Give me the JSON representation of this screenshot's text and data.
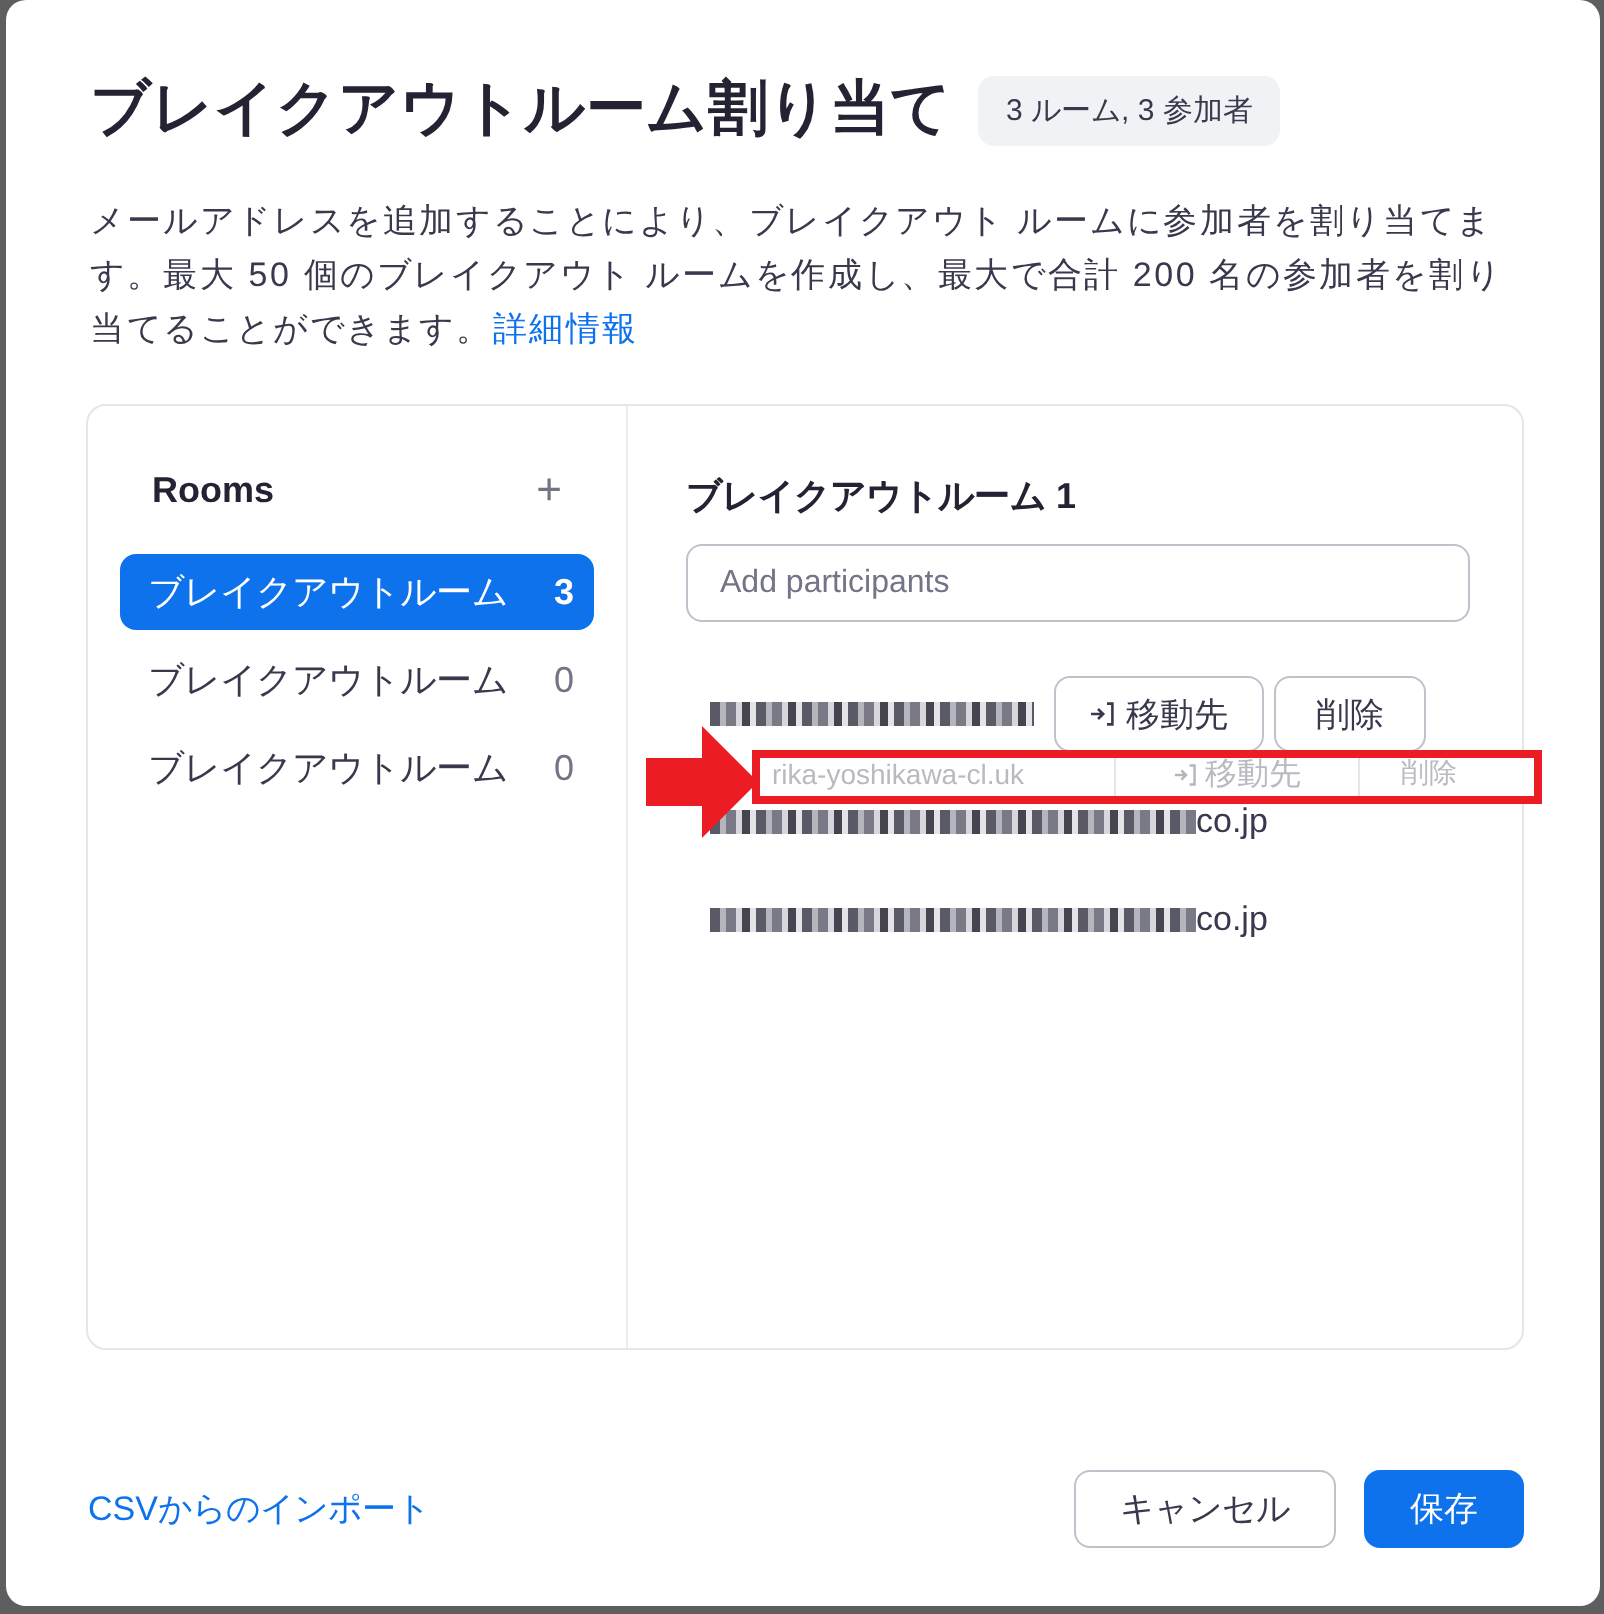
{
  "dialog": {
    "title": "ブレイクアウトルーム割り当て",
    "summary_badge": "3 ルーム, 3 参加者",
    "description": "メールアドレスを追加することにより、ブレイクアウト ルームに参加者を割り当てます。最大 50 個のブレイクアウト ルームを作成し、最大で合計 200 名の参加者を割り当てることができます。",
    "more_info_link": "詳細情報"
  },
  "rooms_panel": {
    "heading": "Rooms",
    "add_button": "+",
    "rooms": [
      {
        "name": "ブレイクアウトルーム",
        "count": "3",
        "selected": true
      },
      {
        "name": "ブレイクアウトルーム",
        "count": "0",
        "selected": false
      },
      {
        "name": "ブレイクアウトルーム",
        "count": "0",
        "selected": false
      }
    ]
  },
  "room_detail": {
    "heading": "ブレイクアウトルーム 1",
    "participant_field": {
      "placeholder": "Add participants"
    },
    "participants": [
      {
        "redacted": true,
        "move_button": "移動先",
        "delete_button": "削除"
      },
      {
        "redacted": true,
        "email_tail": "co.jp"
      },
      {
        "redacted": true,
        "email_tail": "co.jp"
      }
    ],
    "drag_preview": {
      "email": "rika-yoshikawa-cl.uk",
      "move_button": "移動先",
      "delete_button": "削除"
    }
  },
  "footer": {
    "import_link": "CSVからのインポート",
    "buttons": [
      {
        "label": "キャンセル",
        "kind": "secondary"
      },
      {
        "label": "保存",
        "kind": "primary"
      }
    ]
  }
}
